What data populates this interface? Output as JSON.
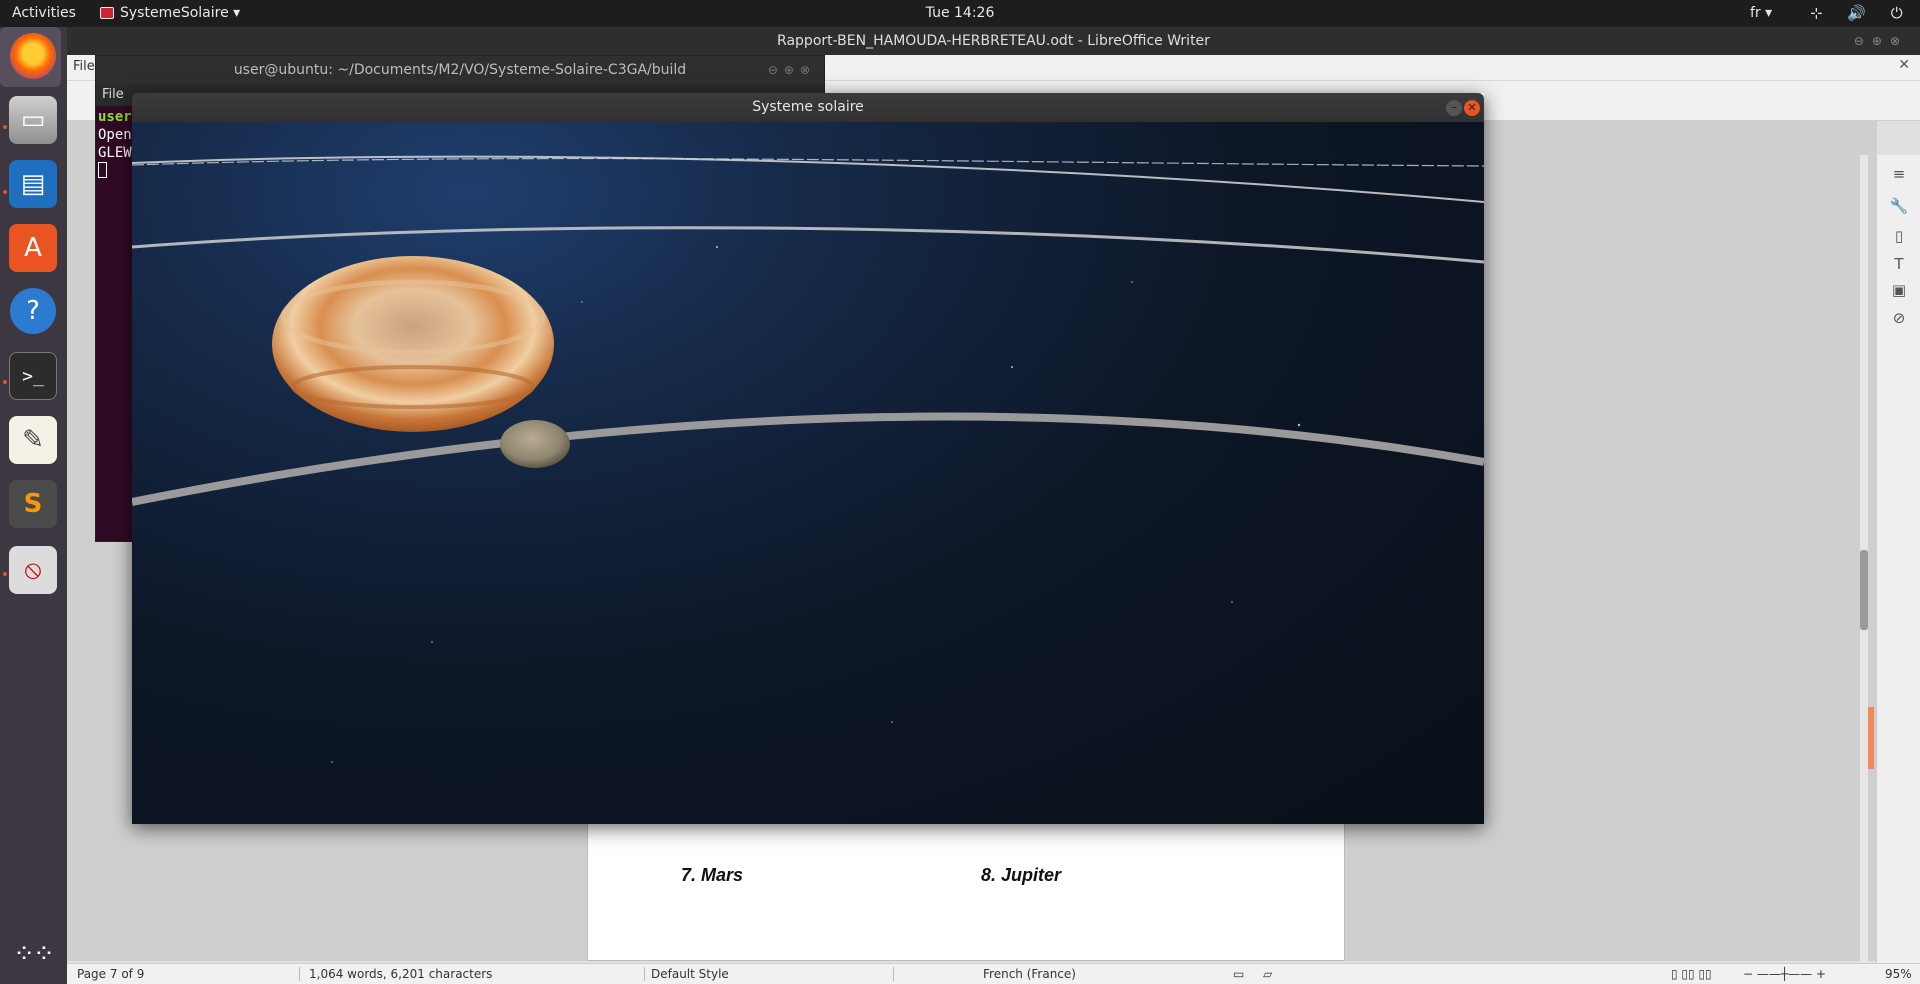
{
  "topbar": {
    "activities": "Activities",
    "app_menu": "SystemeSolaire",
    "clock": "Tue 14:26",
    "language": "fr",
    "system_icons": "⊹ 🔊 ⏻ ▾"
  },
  "dock": {
    "items": [
      "firefox-icon",
      "files-icon",
      "libreoffice-writer-icon",
      "software-store-icon",
      "help-icon",
      "terminal-icon",
      "text-editor-icon",
      "sublime-text-icon",
      "blocked-app-icon",
      "show-apps-icon"
    ],
    "active_indicator_color": "#e95420"
  },
  "terminal": {
    "title": "user@ubuntu: ~/Documents/M2/VO/Systeme-Solaire-C3GA/build",
    "menu_file": "File",
    "lines": [
      "user",
      "Open",
      "GLEW"
    ]
  },
  "writer": {
    "title": "Rapport-BEN_HAMOUDA-HERBRETEAU.odt - LibreOffice Writer",
    "menu_file": "File",
    "caption_mars": "7. Mars",
    "caption_jupiter": "8. Jupiter",
    "status": {
      "page": "Page 7 of 9",
      "words": "1,064 words, 6,201 characters",
      "style": "Default Style",
      "language": "French (France)",
      "zoom": "95%"
    }
  },
  "gl_window": {
    "title": "Systeme solaire",
    "close_color": "#e95420"
  }
}
